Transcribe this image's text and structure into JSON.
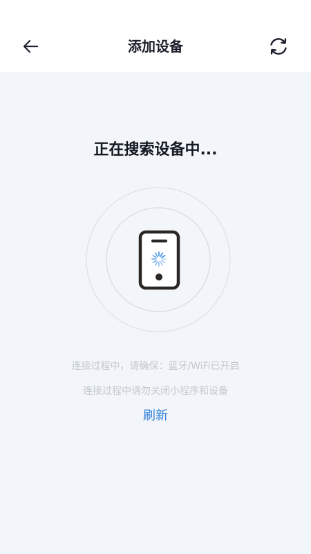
{
  "header": {
    "title": "添加设备",
    "back_icon": "arrow-left-icon",
    "refresh_icon": "refresh-icon"
  },
  "main": {
    "status_text": "正在搜索设备中...",
    "device_icon": "phone-searching-icon",
    "tip_line_1": "连接过程中，请确保：蓝牙/WiFi已开启",
    "tip_line_2": "连接过程中请勿关闭小程序和设备",
    "refresh_label": "刷新"
  },
  "colors": {
    "background": "#f2f5f9",
    "header_background": "#ffffff",
    "link": "#2f7fdc",
    "spinner": "#3d8fe6",
    "tip_text": "#c3c8cf"
  }
}
